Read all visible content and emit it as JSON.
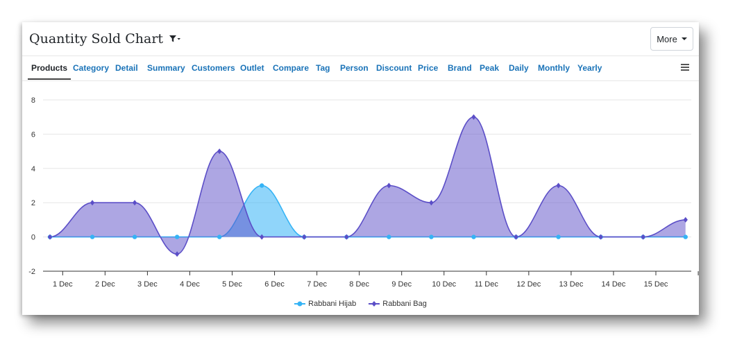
{
  "header": {
    "title": "Quantity Sold Chart",
    "filter_icon": "filter-dropdown-icon",
    "more_label": "More"
  },
  "tabs": [
    {
      "label": "Products",
      "active": true
    },
    {
      "label": "Category"
    },
    {
      "label": "Detail"
    },
    {
      "label": "Summary"
    },
    {
      "label": "Customers"
    },
    {
      "label": "Outlet"
    },
    {
      "label": "Compare"
    },
    {
      "label": "Tag"
    },
    {
      "label": "Person"
    },
    {
      "label": "Discount"
    },
    {
      "label": "Price"
    },
    {
      "label": "Brand"
    },
    {
      "label": "Peak"
    },
    {
      "label": "Daily"
    },
    {
      "label": "Monthly"
    },
    {
      "label": "Yearly"
    }
  ],
  "menu_icon": "hamburger-menu-icon",
  "chart_data": {
    "type": "area",
    "categories": [
      "1 Dec",
      "2 Dec",
      "3 Dec",
      "4 Dec",
      "5 Dec",
      "6 Dec",
      "7 Dec",
      "8 Dec",
      "9 Dec",
      "10 Dec",
      "11 Dec",
      "12 Dec",
      "13 Dec",
      "14 Dec",
      "15 Dec",
      ""
    ],
    "ylim": [
      -2,
      8
    ],
    "yticks": [
      -2,
      0,
      2,
      4,
      6,
      8
    ],
    "grid": true,
    "legend_position": "bottom-center",
    "series": [
      {
        "name": "Rabbani Hijab",
        "color": "#35b3f5",
        "marker": "circle",
        "values": [
          0,
          0,
          0,
          0,
          0,
          3,
          0,
          0,
          0,
          0,
          0,
          0,
          0,
          0,
          0,
          0
        ]
      },
      {
        "name": "Rabbani Bag",
        "color": "#5b4ec7",
        "marker": "diamond",
        "values": [
          0,
          2,
          2,
          -1,
          5,
          0,
          0,
          0,
          3,
          2,
          7,
          0,
          3,
          0,
          0,
          1
        ]
      }
    ]
  }
}
